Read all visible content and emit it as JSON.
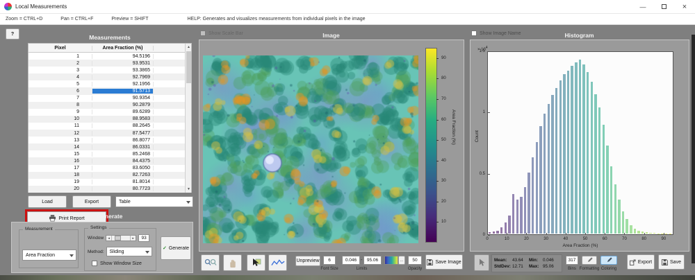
{
  "window": {
    "title": "Local Measurements",
    "minimize": "—",
    "maximize": "",
    "close": "×"
  },
  "menu": {
    "zoom": "Zoom = CTRL+D",
    "pan": "Pan = CTRL+F",
    "preview": "Preview = SHIFT",
    "help": "HELP:  Generates and visualizes measurements from individual pixels in the image"
  },
  "help_button": "?",
  "measurements": {
    "title": "Measurements",
    "columns": [
      "Pixel",
      "Area Fraction (%)"
    ],
    "rows": [
      [
        1,
        "94.5196"
      ],
      [
        2,
        "93.9531"
      ],
      [
        3,
        "93.3865"
      ],
      [
        4,
        "92.7969"
      ],
      [
        5,
        "92.1956"
      ],
      [
        6,
        "91.5713"
      ],
      [
        7,
        "90.9354"
      ],
      [
        8,
        "90.2879"
      ],
      [
        9,
        "89.6289"
      ],
      [
        10,
        "88.9583"
      ],
      [
        11,
        "88.2645"
      ],
      [
        12,
        "87.5477"
      ],
      [
        13,
        "86.8077"
      ],
      [
        14,
        "86.0331"
      ],
      [
        15,
        "85.2468"
      ],
      [
        16,
        "84.4375"
      ],
      [
        17,
        "83.6050"
      ],
      [
        18,
        "82.7263"
      ],
      [
        19,
        "81.8014"
      ],
      [
        20,
        "80.7723"
      ]
    ],
    "selected_row": 6,
    "load_label": "Load",
    "export_label": "Export",
    "export_format_value": "Table",
    "print_report_label": "Print Report"
  },
  "generate": {
    "section_title": "Generate",
    "measurement_group_label": "Measurement",
    "measurement_value": "Area Fraction",
    "settings_group_label": "Settings",
    "window_label": "Window",
    "window_value": "93",
    "method_label": "Method:",
    "method_value": "Sliding",
    "show_window_size_label": "Show Window Size",
    "generate_button_label": "Generate",
    "generate_check": "✓"
  },
  "image_panel": {
    "title": "Image",
    "show_scale_bar_label": "Show Scale Bar",
    "colorbar": {
      "label": "Area Fraction (%)",
      "min": 0,
      "max": 95,
      "ticks": [
        10,
        20,
        30,
        40,
        50,
        60,
        70,
        80,
        90
      ]
    },
    "toolbar": {
      "unpreview_label": "Unpreview",
      "font_size_value": "6",
      "font_size_label": "Font Size",
      "limit_min": "0.046",
      "limit_max": "95.06",
      "limits_label": "Limits",
      "opacity_value": "50",
      "opacity_label": "Opacity",
      "save_image_label": "Save Image"
    }
  },
  "histogram_panel": {
    "title": "Histogram",
    "show_image_name_label": "Show Image Name",
    "stats": {
      "mean_label": "Mean:",
      "mean": "43.64",
      "stddev_label": "StdDev:",
      "stddev": "12.71",
      "min_label": "Min:",
      "min": "0.046",
      "max_label": "Max:",
      "max": "95.06"
    },
    "bins_value": "317",
    "bins_label": "Bins",
    "formatting_label": "Formatting",
    "coloring_label": "Coloring",
    "export_label": "Export",
    "save_label": "Save"
  },
  "chart_data": {
    "type": "bar",
    "title": "Histogram",
    "xlabel": "Area Fraction (%)",
    "ylabel": "Count",
    "xlim": [
      0,
      95
    ],
    "ylim": [
      0,
      15000
    ],
    "grid": false,
    "legend": "none",
    "colormap": "viridis (bars colored by x value)",
    "y_exponent_base": "× 10",
    "y_exponent_power": "4",
    "x_ticks": [
      0,
      10,
      20,
      30,
      40,
      50,
      60,
      70,
      80,
      90
    ],
    "y_ticks": [
      {
        "v": 0,
        "label": "0"
      },
      {
        "v": 5000,
        "label": "0.5"
      },
      {
        "v": 10000,
        "label": "1"
      },
      {
        "v": 15000,
        "label": "1.5"
      }
    ],
    "bin_width": 2,
    "bin_start": [
      0,
      2,
      4,
      6,
      8,
      10,
      12,
      14,
      16,
      18,
      20,
      22,
      24,
      26,
      28,
      30,
      32,
      34,
      36,
      38,
      40,
      42,
      44,
      46,
      48,
      50,
      52,
      54,
      56,
      58,
      60,
      62,
      64,
      66,
      68,
      70,
      72,
      74,
      76,
      78,
      80,
      82,
      84,
      86,
      88,
      90,
      92,
      94
    ],
    "counts": [
      100,
      150,
      250,
      500,
      900,
      1500,
      3200,
      2800,
      3000,
      3800,
      5000,
      6200,
      7500,
      8800,
      9800,
      10600,
      11300,
      11900,
      12500,
      13000,
      13300,
      13700,
      14000,
      14200,
      13800,
      13200,
      12400,
      11400,
      10300,
      8900,
      7200,
      5500,
      4000,
      2800,
      1800,
      1200,
      700,
      400,
      250,
      150,
      100,
      60,
      40,
      25,
      15,
      10,
      5,
      3
    ]
  },
  "colors": {
    "selection_blue": "#2b7cd3",
    "annotation_red": "#cc1111",
    "check_green": "#2e8b2e",
    "coloring_active_bg": "#cfe7f8",
    "main_bg": "#7f7f7f"
  }
}
